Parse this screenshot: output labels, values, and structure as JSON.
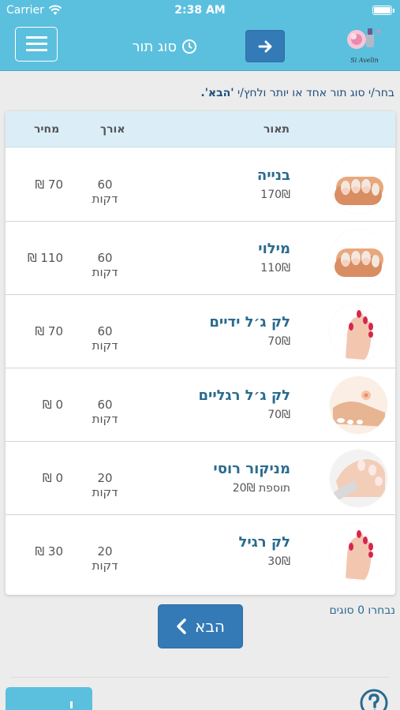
{
  "status_bar": {
    "carrier": "Carrier",
    "time": "2:38 AM"
  },
  "navbar": {
    "title": "סוג תור",
    "logo_text": "Si Avelin"
  },
  "instructions": {
    "text": "בחר/י סוג תור אחד או יותר ולחץ/י ",
    "highlight": "'הבא'."
  },
  "table": {
    "headers": {
      "description": "תאור",
      "length": "אורך",
      "price": "מחיר"
    },
    "rows": [
      {
        "name": "בנייה",
        "sub": "170₪",
        "length": "60 דקות",
        "price": "70 ₪",
        "image": "nails-french"
      },
      {
        "name": "מילוי",
        "sub": "110₪",
        "length": "60 דקות",
        "price": "110 ₪",
        "image": "nails-french"
      },
      {
        "name": "לק ג׳ל ידיים",
        "sub": "70₪",
        "length": "60 דקות",
        "price": "70 ₪",
        "image": "red-nails-hand"
      },
      {
        "name": "לק ג׳ל רגליים",
        "sub": "70₪",
        "length": "60 דקות",
        "price": "0 ₪",
        "image": "feet-flower"
      },
      {
        "name": "מניקור רוסי",
        "sub": "תוספת 20₪",
        "length": "20 דקות",
        "price": "0 ₪",
        "image": "manicure-file"
      },
      {
        "name": "לק רגיל",
        "sub": "30₪",
        "length": "20 דקות",
        "price": "30 ₪",
        "image": "red-nails-hand"
      }
    ]
  },
  "footer": {
    "selected_text": "נבחרו 0 סוגים",
    "next_label": "הבא"
  },
  "colors": {
    "primary": "#5bc0de",
    "button": "#337ab7",
    "text_blue": "#2a6b8f"
  }
}
